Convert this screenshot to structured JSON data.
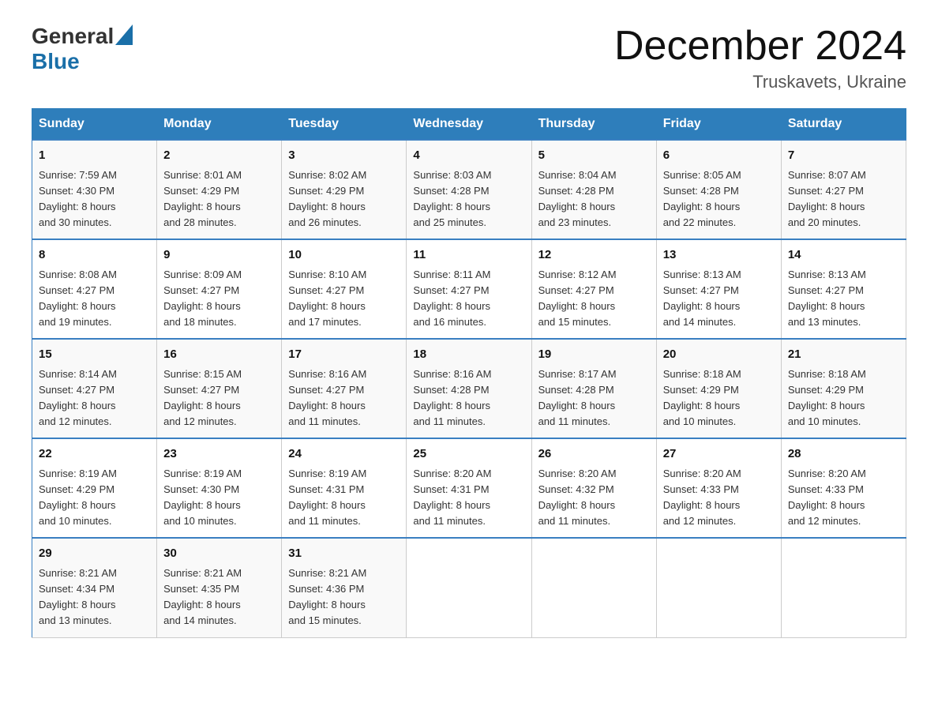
{
  "logo": {
    "general": "General",
    "blue": "Blue"
  },
  "title": "December 2024",
  "location": "Truskavets, Ukraine",
  "days_header": [
    "Sunday",
    "Monday",
    "Tuesday",
    "Wednesday",
    "Thursday",
    "Friday",
    "Saturday"
  ],
  "weeks": [
    [
      {
        "day": "1",
        "info": "Sunrise: 7:59 AM\nSunset: 4:30 PM\nDaylight: 8 hours\nand 30 minutes."
      },
      {
        "day": "2",
        "info": "Sunrise: 8:01 AM\nSunset: 4:29 PM\nDaylight: 8 hours\nand 28 minutes."
      },
      {
        "day": "3",
        "info": "Sunrise: 8:02 AM\nSunset: 4:29 PM\nDaylight: 8 hours\nand 26 minutes."
      },
      {
        "day": "4",
        "info": "Sunrise: 8:03 AM\nSunset: 4:28 PM\nDaylight: 8 hours\nand 25 minutes."
      },
      {
        "day": "5",
        "info": "Sunrise: 8:04 AM\nSunset: 4:28 PM\nDaylight: 8 hours\nand 23 minutes."
      },
      {
        "day": "6",
        "info": "Sunrise: 8:05 AM\nSunset: 4:28 PM\nDaylight: 8 hours\nand 22 minutes."
      },
      {
        "day": "7",
        "info": "Sunrise: 8:07 AM\nSunset: 4:27 PM\nDaylight: 8 hours\nand 20 minutes."
      }
    ],
    [
      {
        "day": "8",
        "info": "Sunrise: 8:08 AM\nSunset: 4:27 PM\nDaylight: 8 hours\nand 19 minutes."
      },
      {
        "day": "9",
        "info": "Sunrise: 8:09 AM\nSunset: 4:27 PM\nDaylight: 8 hours\nand 18 minutes."
      },
      {
        "day": "10",
        "info": "Sunrise: 8:10 AM\nSunset: 4:27 PM\nDaylight: 8 hours\nand 17 minutes."
      },
      {
        "day": "11",
        "info": "Sunrise: 8:11 AM\nSunset: 4:27 PM\nDaylight: 8 hours\nand 16 minutes."
      },
      {
        "day": "12",
        "info": "Sunrise: 8:12 AM\nSunset: 4:27 PM\nDaylight: 8 hours\nand 15 minutes."
      },
      {
        "day": "13",
        "info": "Sunrise: 8:13 AM\nSunset: 4:27 PM\nDaylight: 8 hours\nand 14 minutes."
      },
      {
        "day": "14",
        "info": "Sunrise: 8:13 AM\nSunset: 4:27 PM\nDaylight: 8 hours\nand 13 minutes."
      }
    ],
    [
      {
        "day": "15",
        "info": "Sunrise: 8:14 AM\nSunset: 4:27 PM\nDaylight: 8 hours\nand 12 minutes."
      },
      {
        "day": "16",
        "info": "Sunrise: 8:15 AM\nSunset: 4:27 PM\nDaylight: 8 hours\nand 12 minutes."
      },
      {
        "day": "17",
        "info": "Sunrise: 8:16 AM\nSunset: 4:27 PM\nDaylight: 8 hours\nand 11 minutes."
      },
      {
        "day": "18",
        "info": "Sunrise: 8:16 AM\nSunset: 4:28 PM\nDaylight: 8 hours\nand 11 minutes."
      },
      {
        "day": "19",
        "info": "Sunrise: 8:17 AM\nSunset: 4:28 PM\nDaylight: 8 hours\nand 11 minutes."
      },
      {
        "day": "20",
        "info": "Sunrise: 8:18 AM\nSunset: 4:29 PM\nDaylight: 8 hours\nand 10 minutes."
      },
      {
        "day": "21",
        "info": "Sunrise: 8:18 AM\nSunset: 4:29 PM\nDaylight: 8 hours\nand 10 minutes."
      }
    ],
    [
      {
        "day": "22",
        "info": "Sunrise: 8:19 AM\nSunset: 4:29 PM\nDaylight: 8 hours\nand 10 minutes."
      },
      {
        "day": "23",
        "info": "Sunrise: 8:19 AM\nSunset: 4:30 PM\nDaylight: 8 hours\nand 10 minutes."
      },
      {
        "day": "24",
        "info": "Sunrise: 8:19 AM\nSunset: 4:31 PM\nDaylight: 8 hours\nand 11 minutes."
      },
      {
        "day": "25",
        "info": "Sunrise: 8:20 AM\nSunset: 4:31 PM\nDaylight: 8 hours\nand 11 minutes."
      },
      {
        "day": "26",
        "info": "Sunrise: 8:20 AM\nSunset: 4:32 PM\nDaylight: 8 hours\nand 11 minutes."
      },
      {
        "day": "27",
        "info": "Sunrise: 8:20 AM\nSunset: 4:33 PM\nDaylight: 8 hours\nand 12 minutes."
      },
      {
        "day": "28",
        "info": "Sunrise: 8:20 AM\nSunset: 4:33 PM\nDaylight: 8 hours\nand 12 minutes."
      }
    ],
    [
      {
        "day": "29",
        "info": "Sunrise: 8:21 AM\nSunset: 4:34 PM\nDaylight: 8 hours\nand 13 minutes."
      },
      {
        "day": "30",
        "info": "Sunrise: 8:21 AM\nSunset: 4:35 PM\nDaylight: 8 hours\nand 14 minutes."
      },
      {
        "day": "31",
        "info": "Sunrise: 8:21 AM\nSunset: 4:36 PM\nDaylight: 8 hours\nand 15 minutes."
      },
      {
        "day": "",
        "info": ""
      },
      {
        "day": "",
        "info": ""
      },
      {
        "day": "",
        "info": ""
      },
      {
        "day": "",
        "info": ""
      }
    ]
  ]
}
